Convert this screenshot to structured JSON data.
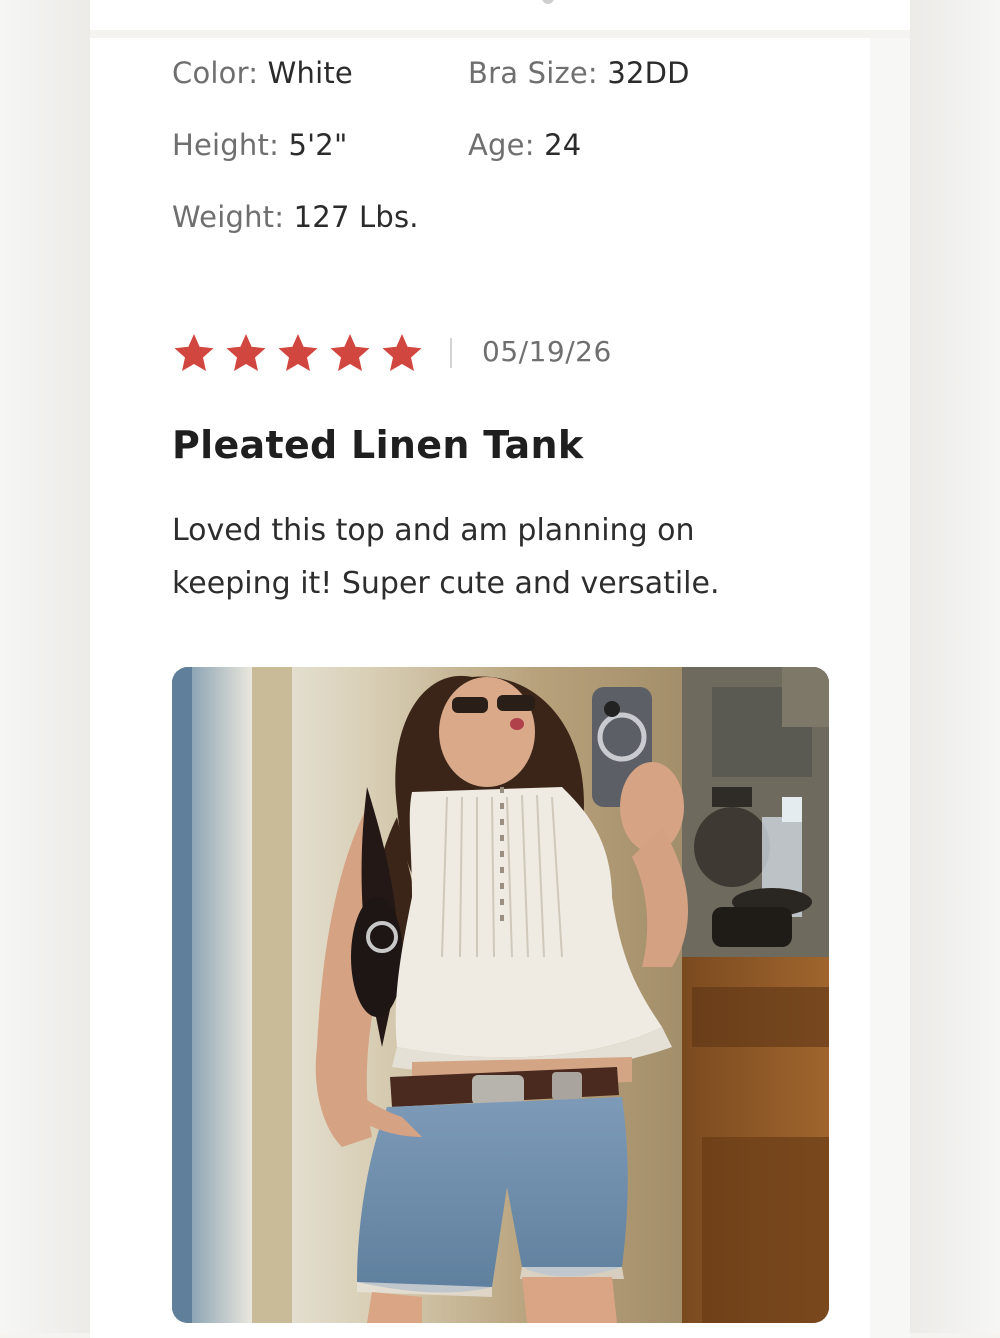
{
  "review": {
    "attributes": {
      "color": {
        "label": "Color:",
        "value": "White"
      },
      "bra_size": {
        "label": "Bra Size:",
        "value": "32DD"
      },
      "height": {
        "label": "Height:",
        "value": "5'2\""
      },
      "age": {
        "label": "Age:",
        "value": "24"
      },
      "weight": {
        "label": "Weight:",
        "value": "127 Lbs."
      }
    },
    "rating": {
      "value": 5,
      "max": 5,
      "star_color": "#d1463f"
    },
    "date": "05/19/26",
    "title": "Pleated Linen Tank",
    "text": "Loved this top and am planning on keeping it! Super cute and versatile.",
    "photo": {
      "icon": "review-photo"
    }
  }
}
